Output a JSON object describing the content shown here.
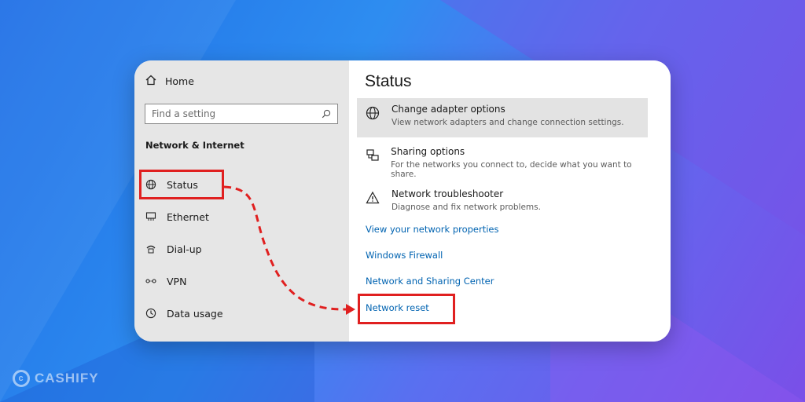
{
  "sidebar": {
    "home_label": "Home",
    "search_placeholder": "Find a setting",
    "section_heading": "Network & Internet",
    "items": [
      {
        "label": "Status",
        "icon": "globe-icon"
      },
      {
        "label": "Ethernet",
        "icon": "ethernet-icon"
      },
      {
        "label": "Dial-up",
        "icon": "phone-icon"
      },
      {
        "label": "VPN",
        "icon": "vpn-icon"
      },
      {
        "label": "Data usage",
        "icon": "clock-icon"
      }
    ],
    "active_item": "Status"
  },
  "main": {
    "title": "Status",
    "options": [
      {
        "title": "Change adapter options",
        "desc": "View network adapters and change connection settings.",
        "icon": "globe-icon",
        "highlighted": true
      },
      {
        "title": "Sharing options",
        "desc": "For the networks you connect to, decide what you want to share.",
        "icon": "sharing-icon",
        "highlighted": false
      },
      {
        "title": "Network troubleshooter",
        "desc": "Diagnose and fix network problems.",
        "icon": "warning-icon",
        "highlighted": false
      }
    ],
    "links": [
      "View your network properties",
      "Windows Firewall",
      "Network and Sharing Center",
      "Network reset"
    ]
  },
  "annotation": {
    "color": "#e02020",
    "from": "Status",
    "to": "Network reset"
  },
  "watermark": {
    "text": "CASHIFY"
  },
  "colors": {
    "link": "#0063b1",
    "sidebar_bg": "#e6e6e6",
    "accent": "#0067c0"
  }
}
